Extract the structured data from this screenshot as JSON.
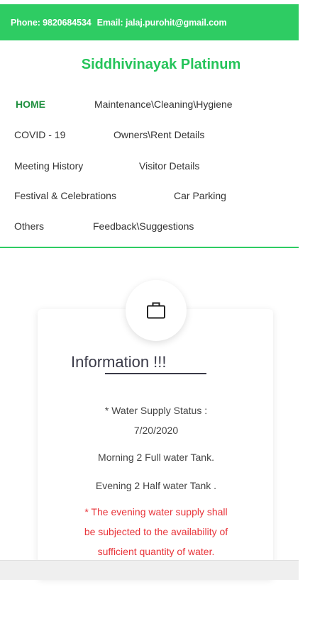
{
  "header": {
    "phone": "Phone: 9820684534",
    "email": "Email: jalaj.purohit@gmail.com"
  },
  "site_title": "Siddhivinayak Platinum",
  "nav": {
    "home": "HOME",
    "maintenance": "Maintenance\\Cleaning\\Hygiene",
    "covid": "COVID - 19",
    "owners": "Owners\\Rent Details",
    "meeting": "Meeting History",
    "visitor": "Visitor Details",
    "festival": "Festival & Celebrations",
    "parking": "Car Parking",
    "others": "Others",
    "feedback": "Feedback\\Suggestions"
  },
  "card": {
    "icon": "briefcase-icon",
    "title": "Information !!!",
    "status_line1": "* Water Supply Status :",
    "status_line2": "7/20/2020",
    "morning": "Morning 2 Full water Tank.",
    "evening": "Evening 2 Half water Tank .",
    "note_line1": "* The evening water supply shall",
    "note_line2": "be subjected to the availability of",
    "note_line3": "sufficient quantity of water."
  },
  "colors": {
    "brand_green": "#2ecc63",
    "title_green": "#25c45a",
    "active_nav": "#1e8f3e",
    "note_red": "#e8343a"
  }
}
